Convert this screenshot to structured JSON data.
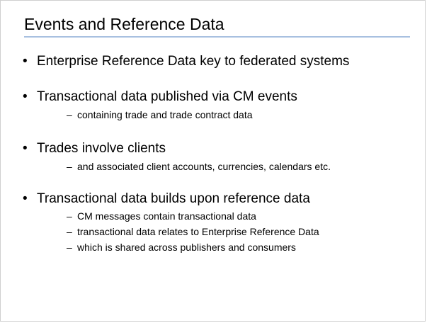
{
  "slide": {
    "title": "Events and Reference Data",
    "bullets": [
      {
        "marker": "•",
        "text": "Enterprise Reference Data key to federated systems",
        "subs": []
      },
      {
        "marker": "•",
        "text": "Transactional data published via CM events",
        "subs": [
          {
            "marker": "–",
            "text": "containing trade and trade contract data"
          }
        ]
      },
      {
        "marker": "•",
        "text": "Trades involve clients",
        "subs": [
          {
            "marker": "–",
            "text": "and associated client accounts, currencies, calendars etc."
          }
        ]
      },
      {
        "marker": "•",
        "text": "Transactional data builds upon reference data",
        "subs": [
          {
            "marker": "–",
            "text": "CM messages contain transactional data"
          },
          {
            "marker": "–",
            "text": "transactional data relates to Enterprise Reference Data"
          },
          {
            "marker": "–",
            "text": "which is shared across publishers and consumers"
          }
        ]
      }
    ]
  },
  "colors": {
    "title_rule": "#a8c0e0",
    "text": "#000000",
    "background": "#ffffff"
  }
}
